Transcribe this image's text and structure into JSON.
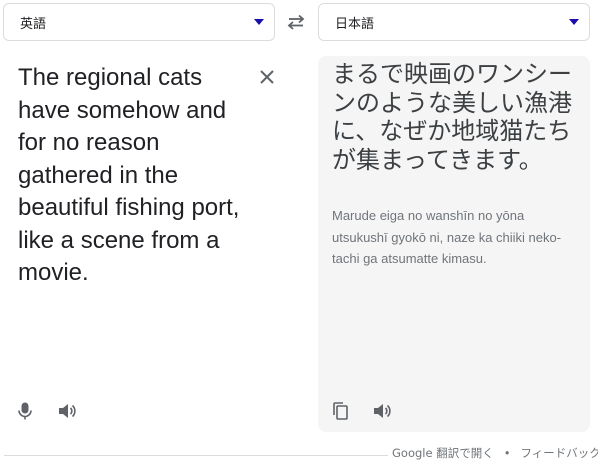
{
  "source_lang": {
    "label": "英語"
  },
  "target_lang": {
    "label": "日本語"
  },
  "source": {
    "text": "The regional cats have somehow and for no reason gathered in the beautiful fishing port, like a scene from a movie."
  },
  "target": {
    "text": "まるで映画のワンシーンのような美しい漁港に、なぜか地域猫たちが集まってきます。",
    "transliteration": "Marude eiga no wanshīn no yōna utsukushī gyokō ni, naze ka chiiki neko-tachi ga atsumatte kimasu."
  },
  "footer": {
    "open_link": "Google 翻訳で開く",
    "separator": "•",
    "feedback_link": "フィードバック"
  },
  "icons": {
    "swap": "swap-icon",
    "clear": "close-icon",
    "mic": "microphone-icon",
    "speaker": "speaker-icon",
    "copy": "copy-icon",
    "dropdown": "chevron-down-icon"
  },
  "colors": {
    "accent": "#1a0dab",
    "icon": "#5f6368",
    "panel_bg": "#f5f5f5"
  }
}
